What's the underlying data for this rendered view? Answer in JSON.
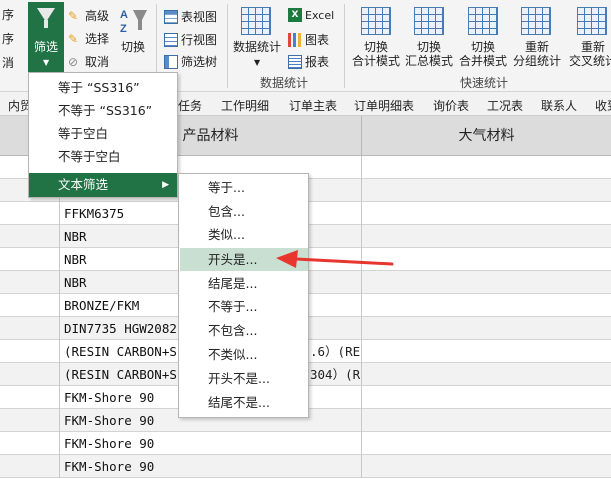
{
  "ribbon": {
    "sort_partial": "序",
    "sort2_partial": "序",
    "cancel_partial": "消",
    "filter_label": "筛选",
    "advanced_label": "高级",
    "select_label": "选择",
    "cancel_label": "取消",
    "switch_label": "切换",
    "table_view_label": "表视图",
    "row_view_label": "行视图",
    "filter_tree_label": "筛选树",
    "data_stats_label": "数据统计",
    "excel_label": "Excel",
    "chart_label": "图表",
    "report_label": "报表",
    "group_data_stats": "数据统计",
    "switch_total_line1": "切换",
    "switch_total_line2": "合计模式",
    "switch_summary_line1": "切换",
    "switch_summary_line2": "汇总模式",
    "switch_merge_line1": "切换",
    "switch_merge_line2": "合并模式",
    "regroup_line1": "重新",
    "regroup_line2": "分组统计",
    "recross_line1": "重新",
    "recross_line2": "交叉统计",
    "group_quick_stats": "快速统计",
    "accent_color": "#217346"
  },
  "tabs": [
    "内贸",
    "任务",
    "工作明细",
    "订单主表",
    "订单明细表",
    "询价表",
    "工况表",
    "联系人",
    "收到"
  ],
  "grid": {
    "columns": [
      "产品材料",
      "大气材料"
    ],
    "rows": [
      "",
      "",
      "FFKM6375",
      "NBR",
      "NBR",
      "NBR",
      "BRONZE/FKM",
      "DIN7735 HGW2082",
      "(RESIN CARBON+S",
      "(RESIN CARBON+S",
      "FKM-Shore 90",
      "FKM-Shore 90",
      "FKM-Shore 90",
      "FKM-Shore 90"
    ],
    "overflow_text_1": ".6）(RE",
    "overflow_text_2": "304）(R"
  },
  "filter_menu": {
    "items": [
      "等于 “SS316”",
      "不等于 “SS316”",
      "等于空白",
      "不等于空白",
      "文本筛选"
    ]
  },
  "text_filter_menu": {
    "items": [
      "等于...",
      "包含...",
      "类似...",
      "开头是...",
      "结尾是...",
      "不等于...",
      "不包含...",
      "不类似...",
      "开头不是...",
      "结尾不是..."
    ],
    "selected": "开头是..."
  },
  "annotation_color": "#e8352e"
}
